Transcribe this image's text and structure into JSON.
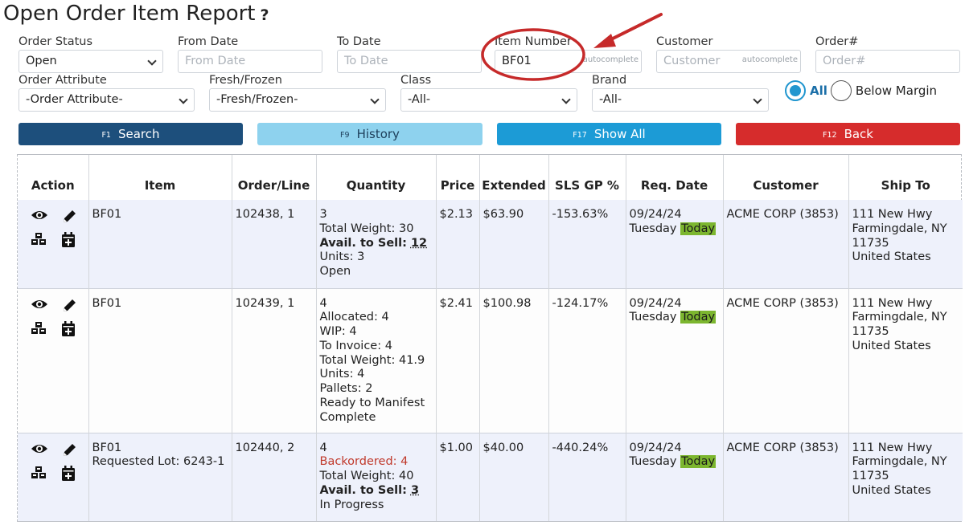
{
  "page": {
    "title": "Open Order Item Report",
    "help_glyph": "?"
  },
  "filters": {
    "order_status": {
      "label": "Order Status",
      "value": "Open"
    },
    "from_date": {
      "label": "From Date",
      "placeholder": "From Date"
    },
    "to_date": {
      "label": "To Date",
      "placeholder": "To Date"
    },
    "item_number": {
      "label": "Item Number",
      "value": "BF01",
      "hint": "autocomplete"
    },
    "customer": {
      "label": "Customer",
      "placeholder": "Customer",
      "hint": "autocomplete"
    },
    "order_no": {
      "label": "Order#",
      "placeholder": "Order#"
    },
    "order_attribute": {
      "label": "Order Attribute",
      "value": "-Order Attribute-"
    },
    "fresh_frozen": {
      "label": "Fresh/Frozen",
      "value": "-Fresh/Frozen-"
    },
    "class": {
      "label": "Class",
      "value": "-All-"
    },
    "brand": {
      "label": "Brand",
      "value": "-All-"
    },
    "margin": {
      "all_label": "All",
      "below_label": "Below Margin",
      "selected": "All"
    }
  },
  "buttons": {
    "search": {
      "key": "F1",
      "label": "Search"
    },
    "history": {
      "key": "F9",
      "label": "History"
    },
    "show_all": {
      "key": "F17",
      "label": "Show All"
    },
    "back": {
      "key": "F12",
      "label": "Back"
    }
  },
  "table": {
    "headers": [
      "Action",
      "Item",
      "Order/Line",
      "Quantity",
      "Price",
      "Extended",
      "SLS GP %",
      "Req. Date",
      "Customer",
      "Ship To"
    ],
    "rows": [
      {
        "item": "BF01",
        "item_extra": "",
        "order_line": "102438, 1",
        "qty": "3",
        "total_weight": "Total Weight: 30",
        "avail_label": "Avail. to Sell:",
        "avail_value": "12",
        "units": "Units: 3",
        "status": "Open",
        "price": "$2.13",
        "extended": "$63.90",
        "gp": "-153.63%",
        "date": "09/24/24",
        "weekday": "Tuesday",
        "today": "Today",
        "customer": "ACME CORP (3853)",
        "ship": [
          "111 New Hwy",
          "Farmingdale, NY",
          "11735",
          "United States"
        ]
      },
      {
        "item": "BF01",
        "item_extra": "",
        "order_line": "102439, 1",
        "qty": "4",
        "details": [
          "Allocated: 4",
          "WIP: 4",
          "To Invoice: 4",
          "Total Weight: 41.9",
          "Units: 4",
          "Pallets: 2",
          "Ready to Manifest",
          "Complete"
        ],
        "price": "$2.41",
        "extended": "$100.98",
        "gp": "-124.17%",
        "date": "09/24/24",
        "weekday": "Tuesday",
        "today": "Today",
        "customer": "ACME CORP (3853)",
        "ship": [
          "111 New Hwy",
          "Farmingdale, NY",
          "11735",
          "United States"
        ]
      },
      {
        "item": "BF01",
        "item_extra": "Requested Lot: 6243-1",
        "order_line": "102440, 2",
        "qty": "4",
        "backordered": "Backordered: 4",
        "total_weight": "Total Weight: 40",
        "avail_label": "Avail. to Sell:",
        "avail_value": "3",
        "status": "In Progress",
        "price": "$1.00",
        "extended": "$40.00",
        "gp": "-440.24%",
        "date": "09/24/24",
        "weekday": "Tuesday",
        "today": "Today",
        "customer": "ACME CORP (3853)",
        "ship": [
          "111 New Hwy",
          "Farmingdale, NY",
          "11735",
          "United States"
        ]
      }
    ]
  },
  "icons": {
    "row_actions": [
      "eye-icon",
      "pencil-icon",
      "cubes-icon",
      "calendar-plus-icon"
    ]
  },
  "colors": {
    "search": "#1d4f7c",
    "history": "#8ed2ee",
    "show_all": "#1c9bd6",
    "back": "#d62c2c",
    "today_highlight": "#7cb62f",
    "annotation": "#c62a2a",
    "radio_selected": "#2196cf"
  }
}
